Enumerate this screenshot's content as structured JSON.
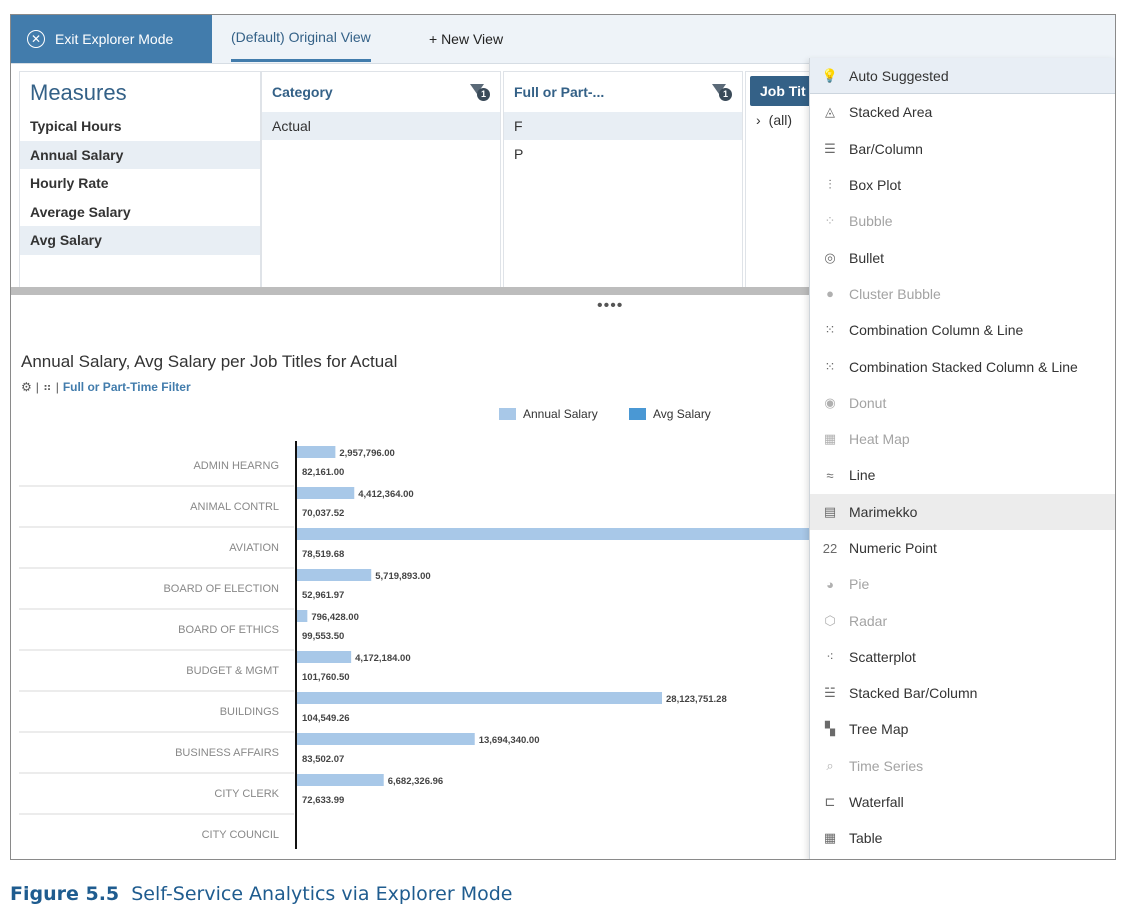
{
  "toolbar": {
    "exit_label": "Exit Explorer Mode",
    "tab_default": "(Default) Original View",
    "tab_new": "+ New View"
  },
  "measures": {
    "title": "Measures",
    "items": [
      "Typical Hours",
      "Annual Salary",
      "Hourly Rate",
      "Average Salary",
      "Avg Salary"
    ]
  },
  "dimensions": [
    {
      "title": "Category",
      "filter_count": "1",
      "values": [
        "Actual"
      ]
    },
    {
      "title": "Full or Part-...",
      "filter_count": "1",
      "values": [
        "F",
        "P"
      ]
    },
    {
      "title": "Job Tit",
      "values": [
        "(all)"
      ]
    }
  ],
  "chart_header": {
    "title": "Annual Salary, Avg Salary per Job Titles for Actual",
    "filter_link": "Full or Part-Time Filter",
    "separator": "|"
  },
  "chart_data": {
    "type": "bar",
    "orientation": "horizontal",
    "categories": [
      "ADMIN HEARNG",
      "ANIMAL CONTRL",
      "AVIATION",
      "BOARD OF ELECTION",
      "BOARD OF ETHICS",
      "BUDGET & MGMT",
      "BUILDINGS",
      "BUSINESS AFFAIRS",
      "CITY CLERK",
      "CITY COUNCIL"
    ],
    "series": [
      {
        "name": "Annual Salary",
        "color": "#a8c8e8",
        "values": [
          2957796.0,
          4412364.0,
          40000000,
          5719893.0,
          796428.0,
          4172184.0,
          28123751.28,
          13694340.0,
          6682326.96,
          null
        ],
        "labels": [
          "2,957,796.00",
          "4,412,364.00",
          "",
          "5,719,893.00",
          "796,428.00",
          "4,172,184.00",
          "28,123,751.28",
          "13,694,340.00",
          "6,682,326.96",
          ""
        ]
      },
      {
        "name": "Avg Salary",
        "color": "#4a98d4",
        "values": [
          82161.0,
          70037.52,
          78519.68,
          52961.97,
          99553.5,
          101760.5,
          104549.26,
          83502.07,
          72633.99,
          null
        ],
        "labels": [
          "82,161.00",
          "70,037.52",
          "78,519.68",
          "52,961.97",
          "99,553.50",
          "101,760.50",
          "104,549.26",
          "83,502.07",
          "72,633.99",
          ""
        ]
      }
    ],
    "legend": "top-right",
    "grid": false
  },
  "chart_types": [
    {
      "label": "Auto Suggested",
      "icon": "lightbulb-icon",
      "glyph": "💡",
      "disabled": false
    },
    {
      "label": "Stacked Area",
      "icon": "stacked-area-icon",
      "glyph": "◬",
      "disabled": false
    },
    {
      "label": "Bar/Column",
      "icon": "bar-column-icon",
      "glyph": "☰",
      "disabled": false
    },
    {
      "label": "Box Plot",
      "icon": "box-plot-icon",
      "glyph": "⫶",
      "disabled": false
    },
    {
      "label": "Bubble",
      "icon": "bubble-icon",
      "glyph": "⁘",
      "disabled": true
    },
    {
      "label": "Bullet",
      "icon": "bullet-icon",
      "glyph": "◎",
      "disabled": false
    },
    {
      "label": "Cluster Bubble",
      "icon": "cluster-bubble-icon",
      "glyph": "●",
      "disabled": true
    },
    {
      "label": "Combination Column & Line",
      "icon": "combination-column-line-icon",
      "glyph": "⁙",
      "disabled": false
    },
    {
      "label": "Combination Stacked Column & Line",
      "icon": "combination-stacked-column-line-icon",
      "glyph": "⁙",
      "disabled": false
    },
    {
      "label": "Donut",
      "icon": "donut-icon",
      "glyph": "◉",
      "disabled": true
    },
    {
      "label": "Heat Map",
      "icon": "heat-map-icon",
      "glyph": "▦",
      "disabled": true
    },
    {
      "label": "Line",
      "icon": "line-icon",
      "glyph": "≈",
      "disabled": false
    },
    {
      "label": "Marimekko",
      "icon": "marimekko-icon",
      "glyph": "▤",
      "disabled": false,
      "hover": true
    },
    {
      "label": "Numeric Point",
      "icon": "numeric-point-icon",
      "glyph": "22",
      "disabled": false
    },
    {
      "label": "Pie",
      "icon": "pie-icon",
      "glyph": "◕",
      "disabled": true
    },
    {
      "label": "Radar",
      "icon": "radar-icon",
      "glyph": "⬡",
      "disabled": true
    },
    {
      "label": "Scatterplot",
      "icon": "scatterplot-icon",
      "glyph": "⁖",
      "disabled": false
    },
    {
      "label": "Stacked Bar/Column",
      "icon": "stacked-bar-column-icon",
      "glyph": "☱",
      "disabled": false
    },
    {
      "label": "Tree Map",
      "icon": "tree-map-icon",
      "glyph": "▚",
      "disabled": false
    },
    {
      "label": "Time Series",
      "icon": "time-series-icon",
      "glyph": "⌕",
      "disabled": true
    },
    {
      "label": "Waterfall",
      "icon": "waterfall-icon",
      "glyph": "⊏",
      "disabled": false
    },
    {
      "label": "Table",
      "icon": "table-icon",
      "glyph": "▦",
      "disabled": false
    }
  ],
  "caption": {
    "figure": "Figure 5.5",
    "text": "Self-Service Analytics via Explorer Mode"
  }
}
